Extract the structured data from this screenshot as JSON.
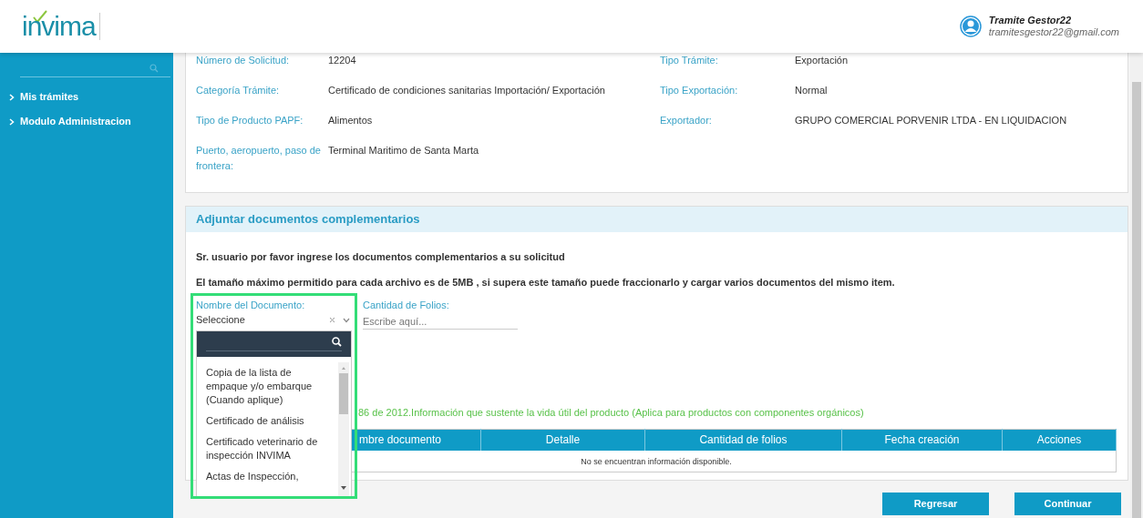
{
  "header": {
    "logo": "invima",
    "user": {
      "name": "Tramite Gestor22",
      "email": "tramitesgestor22@gmail.com"
    }
  },
  "sidebar": {
    "items": [
      {
        "label": "Mis trámites"
      },
      {
        "label": "Modulo Administracion"
      }
    ]
  },
  "request_info": {
    "rows": [
      {
        "left": {
          "label": "Número de Solicitud:",
          "value": "12204"
        },
        "right": {
          "label": "Tipo Trámite:",
          "value": "Exportación"
        }
      },
      {
        "left": {
          "label": "Categoría Trámite:",
          "value": "Certificado de condiciones sanitarias Importación/ Exportación"
        },
        "right": {
          "label": "Tipo Exportación:",
          "value": "Normal"
        }
      },
      {
        "left": {
          "label": "Tipo de Producto PAPF:",
          "value": "Alimentos"
        },
        "right": {
          "label": "Exportador:",
          "value": "GRUPO COMERCIAL PORVENIR LTDA - EN LIQUIDACION"
        }
      },
      {
        "left": {
          "label": "Puerto, aeropuerto, paso de frontera:",
          "value": "Terminal Maritimo de Santa Marta"
        }
      }
    ]
  },
  "attachments": {
    "title": "Adjuntar documentos complementarios",
    "instructions": [
      "Sr. usuario por favor ingrese los documentos complementarios a su solicitud",
      "El tamaño máximo permitido para cada archivo es de 5MB , si supera este tamaño puede fraccionarlo y cargar varios documentos del mismo item."
    ],
    "document_field": {
      "label": "Nombre del Documento:",
      "value": "Seleccione",
      "expanded": true,
      "highlighted": true,
      "options": [
        {
          "label": "Copia de la lista de empaque y/o embarque (Cuando aplique)"
        },
        {
          "label": "Certificado de análisis"
        },
        {
          "label": "Certificado veterinario de inspección INVIMA"
        },
        {
          "label": "Actas de Inspección,"
        }
      ]
    },
    "folios_field": {
      "label": "Cantidad de Folios:",
      "placeholder": "Escribe aquí..."
    },
    "note": "86 de 2012.Información que sustente la vida útil del producto (Aplica para productos con componentes orgánicos)",
    "table": {
      "columns": [
        "mbre documento",
        "Detalle",
        "Cantidad de folios",
        "Fecha creación",
        "Acciones"
      ],
      "empty_message": "No se encuentran información disponible."
    }
  },
  "buttons": [
    {
      "label": "Regresar"
    },
    {
      "label": "Continuar"
    }
  ]
}
